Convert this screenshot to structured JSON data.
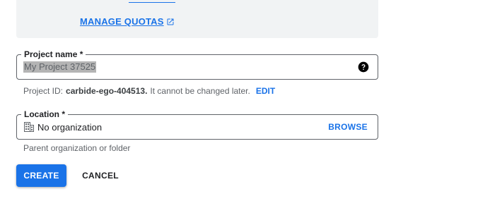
{
  "quota_box": {
    "manage_quotas_label": "MANAGE QUOTAS"
  },
  "project_name": {
    "label": "Project name *",
    "value": "My Project 37525"
  },
  "project_id": {
    "prefix": "Project ID:",
    "value": "carbide-ego-404513.",
    "note": "It cannot be changed later.",
    "edit_label": "EDIT"
  },
  "location": {
    "label": "Location *",
    "value": "No organization",
    "browse_label": "BROWSE",
    "helper": "Parent organization or folder"
  },
  "actions": {
    "create_label": "CREATE",
    "cancel_label": "CANCEL"
  },
  "colors": {
    "accent": "#1a73e8",
    "panel_bg": "#f1f3f4",
    "border": "#5f6368"
  },
  "icons": {
    "external_link": "open-in-new-icon",
    "help": "help-circle-icon",
    "organization": "building-icon"
  }
}
